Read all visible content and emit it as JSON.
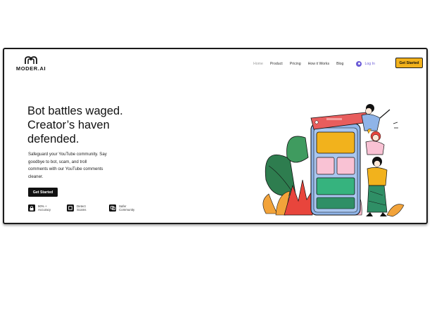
{
  "brand": {
    "name": "MODER.AI"
  },
  "nav": {
    "items": [
      {
        "label": "Home",
        "active": true
      },
      {
        "label": "Product",
        "active": false
      },
      {
        "label": "Pricing",
        "active": false
      },
      {
        "label": "How it Works",
        "active": false
      },
      {
        "label": "Blog",
        "active": false
      }
    ],
    "login_label": "Log In",
    "cta_label": "Get Started"
  },
  "hero": {
    "title_lines": [
      "Bot battles waged.",
      "Creator’s haven",
      "defended."
    ],
    "subtitle_lines": [
      "Safeguard your YouTube community. Say",
      "goodbye to bot, scam, and troll",
      "comments with our YouTube comments",
      "cleaner."
    ],
    "button_label": "Get Started"
  },
  "stats": [
    {
      "icon": "lock-icon",
      "line1": "90% +",
      "line2": "Accuracy"
    },
    {
      "icon": "square-frame-icon",
      "line1": "Detect",
      "line2": "Scams"
    },
    {
      "icon": "community-icon",
      "line1": "Safer",
      "line2": "Community"
    }
  ],
  "colors": {
    "accent": "#f2b21c",
    "login": "#6b5bd6",
    "dark": "#111111"
  }
}
